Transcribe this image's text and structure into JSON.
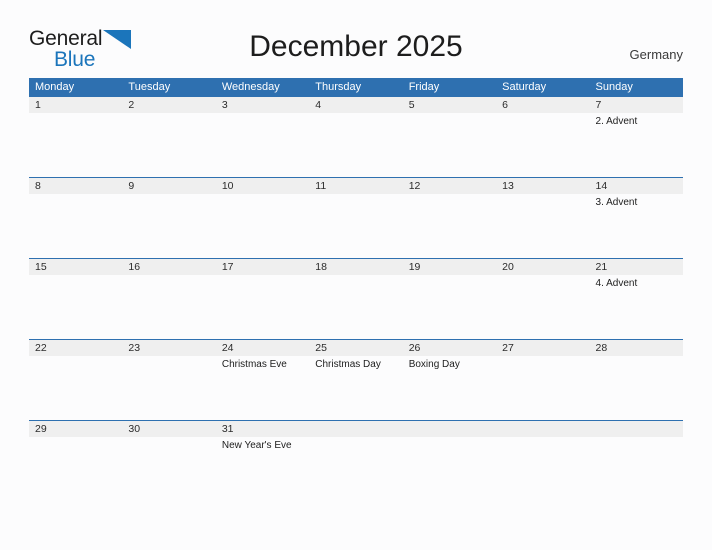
{
  "brand": {
    "name_part1": "General",
    "name_part2": "Blue",
    "flag_icon": "blue-flag-triangle-icon",
    "accent_color": "#1b75bb"
  },
  "header": {
    "title": "December 2025",
    "region": "Germany"
  },
  "theme": {
    "header_blue": "#2e70b0",
    "date_band_gray": "#efefef",
    "page_background": "#fcfcfd",
    "text_dark": "#1d1d1d"
  },
  "calendar": {
    "weekdays": [
      "Monday",
      "Tuesday",
      "Wednesday",
      "Thursday",
      "Friday",
      "Saturday",
      "Sunday"
    ],
    "weeks": [
      [
        {
          "day": "1",
          "event": ""
        },
        {
          "day": "2",
          "event": ""
        },
        {
          "day": "3",
          "event": ""
        },
        {
          "day": "4",
          "event": ""
        },
        {
          "day": "5",
          "event": ""
        },
        {
          "day": "6",
          "event": ""
        },
        {
          "day": "7",
          "event": "2. Advent"
        }
      ],
      [
        {
          "day": "8",
          "event": ""
        },
        {
          "day": "9",
          "event": ""
        },
        {
          "day": "10",
          "event": ""
        },
        {
          "day": "11",
          "event": ""
        },
        {
          "day": "12",
          "event": ""
        },
        {
          "day": "13",
          "event": ""
        },
        {
          "day": "14",
          "event": "3. Advent"
        }
      ],
      [
        {
          "day": "15",
          "event": ""
        },
        {
          "day": "16",
          "event": ""
        },
        {
          "day": "17",
          "event": ""
        },
        {
          "day": "18",
          "event": ""
        },
        {
          "day": "19",
          "event": ""
        },
        {
          "day": "20",
          "event": ""
        },
        {
          "day": "21",
          "event": "4. Advent"
        }
      ],
      [
        {
          "day": "22",
          "event": ""
        },
        {
          "day": "23",
          "event": ""
        },
        {
          "day": "24",
          "event": "Christmas Eve"
        },
        {
          "day": "25",
          "event": "Christmas Day"
        },
        {
          "day": "26",
          "event": "Boxing Day"
        },
        {
          "day": "27",
          "event": ""
        },
        {
          "day": "28",
          "event": ""
        }
      ],
      [
        {
          "day": "29",
          "event": ""
        },
        {
          "day": "30",
          "event": ""
        },
        {
          "day": "31",
          "event": "New Year's Eve"
        },
        {
          "day": "",
          "event": ""
        },
        {
          "day": "",
          "event": ""
        },
        {
          "day": "",
          "event": ""
        },
        {
          "day": "",
          "event": ""
        }
      ]
    ]
  }
}
